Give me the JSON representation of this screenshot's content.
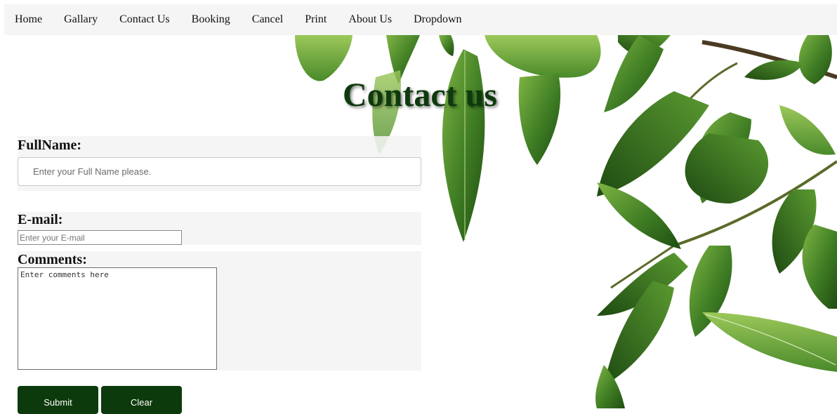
{
  "nav": {
    "items": [
      {
        "label": "Home"
      },
      {
        "label": "Gallary"
      },
      {
        "label": "Contact Us"
      },
      {
        "label": "Booking"
      },
      {
        "label": "Cancel"
      },
      {
        "label": "Print"
      },
      {
        "label": "About Us"
      },
      {
        "label": "Dropdown"
      }
    ]
  },
  "page": {
    "title": "Contact us"
  },
  "form": {
    "fullname": {
      "label": "FullName:",
      "placeholder": "Enter your Full Name please.",
      "value": ""
    },
    "email": {
      "label": "E-mail:",
      "placeholder": "Enter your E-mail",
      "value": ""
    },
    "comments": {
      "label": "Comments:",
      "placeholder": "Enter comments here",
      "value": ""
    },
    "submit_label": "Submit",
    "clear_label": "Clear"
  },
  "colors": {
    "accent": "#0c3a0c",
    "title": "#0e3a0e",
    "leaf_dark": "#2f6b1e",
    "leaf_light": "#6aa23a"
  },
  "background": {
    "image": "leaves-photo"
  }
}
